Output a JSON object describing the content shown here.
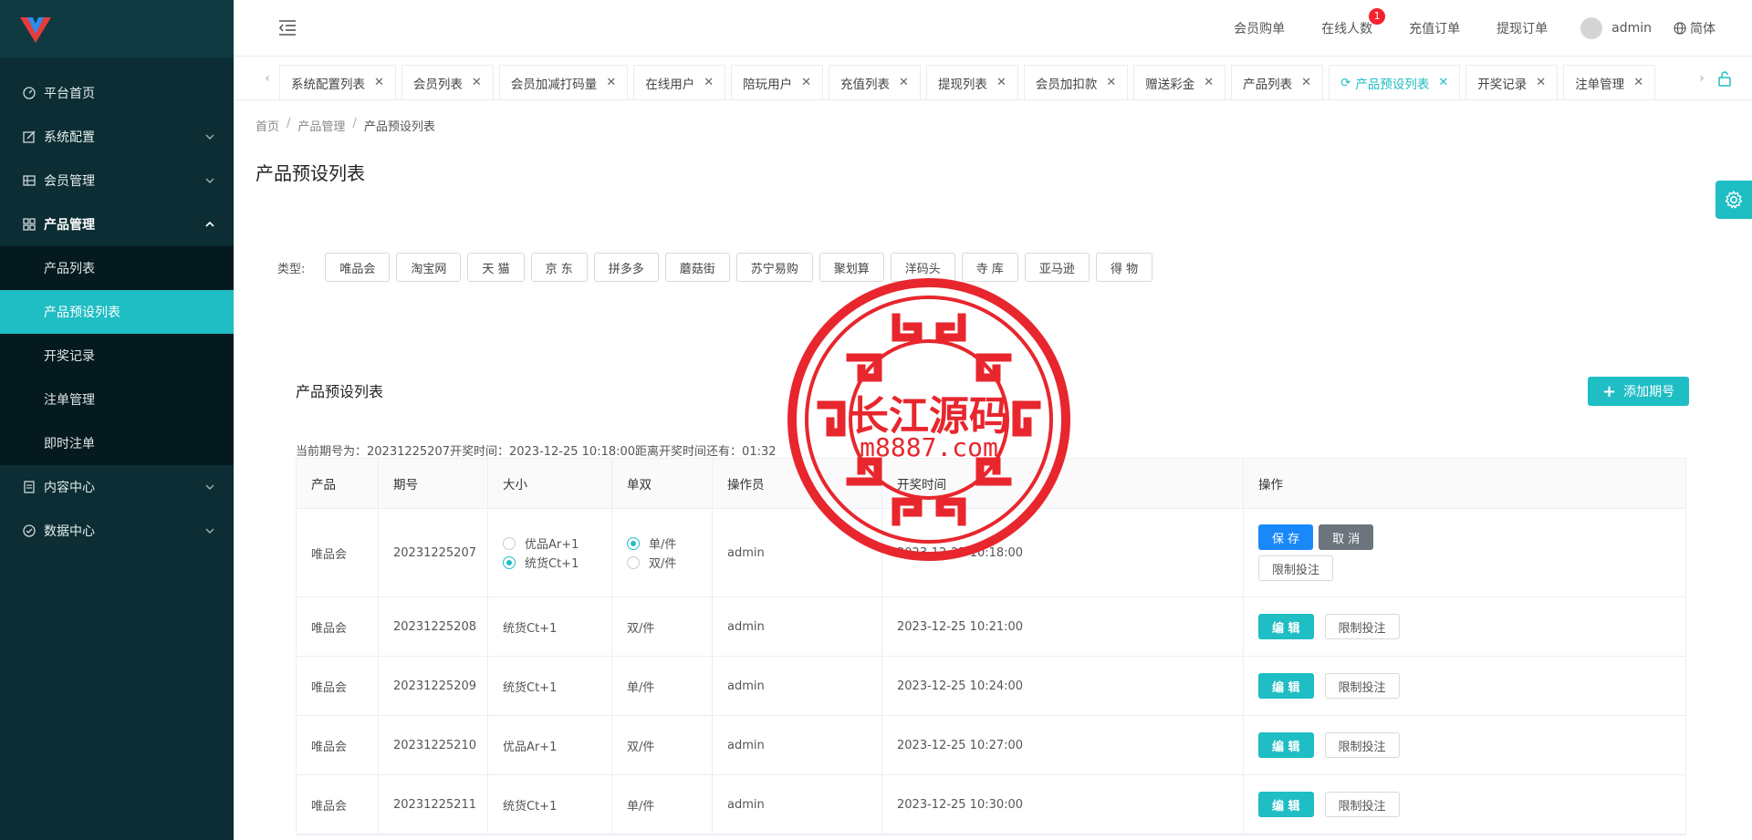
{
  "sidebar": {
    "brand_color": "#e63b3b",
    "items": [
      {
        "label": "平台首页",
        "icon": "dashboard-icon"
      },
      {
        "label": "系统配置",
        "icon": "edit-icon"
      },
      {
        "label": "会员管理",
        "icon": "grid-icon"
      },
      {
        "label": "产品管理",
        "icon": "apps-icon"
      },
      {
        "label": "内容中心",
        "icon": "document-icon"
      },
      {
        "label": "数据中心",
        "icon": "check-circle-icon"
      }
    ],
    "submenu": [
      {
        "label": "产品列表"
      },
      {
        "label": "产品预设列表"
      },
      {
        "label": "开奖记录"
      },
      {
        "label": "注单管理"
      },
      {
        "label": "即时注单"
      }
    ]
  },
  "header": {
    "links": [
      {
        "label": "会员购单"
      },
      {
        "label": "在线人数",
        "badge": "1"
      },
      {
        "label": "充值订单"
      },
      {
        "label": "提现订单"
      }
    ],
    "user": "admin",
    "lang": "简体"
  },
  "tabs": [
    {
      "label": "系统配置列表"
    },
    {
      "label": "会员列表"
    },
    {
      "label": "会员加减打码量"
    },
    {
      "label": "在线用户"
    },
    {
      "label": "陪玩用户"
    },
    {
      "label": "充值列表"
    },
    {
      "label": "提现列表"
    },
    {
      "label": "会员加扣款"
    },
    {
      "label": "赠送彩金"
    },
    {
      "label": "产品列表"
    },
    {
      "label": "产品预设列表"
    },
    {
      "label": "开奖记录"
    },
    {
      "label": "注单管理"
    }
  ],
  "breadcrumb": [
    "首页",
    "产品管理",
    "产品预设列表"
  ],
  "page_title": "产品预设列表",
  "filter": {
    "label": "类型:",
    "types": [
      "唯品会",
      "淘宝网",
      "天 猫",
      "京 东",
      "拼多多",
      "蘑菇街",
      "苏宁易购",
      "聚划算",
      "洋码头",
      "寺 库",
      "亚马逊",
      "得 物"
    ]
  },
  "card": {
    "title": "产品预设列表",
    "add_label": "添加期号",
    "period_info": "当前期号为：20231225207开奖时间：2023-12-25 10:18:00距离开奖时间还有：01:32"
  },
  "table": {
    "headers": [
      "产品",
      "期号",
      "大小",
      "单双",
      "操作员",
      "开奖时间",
      "操作"
    ],
    "edit_row": {
      "product": "唯品会",
      "period": "20231225207",
      "size_options": [
        "优品Ar+1",
        "统货Ct+1"
      ],
      "size_selected": 1,
      "parity_options": [
        "单/件",
        "双/件"
      ],
      "parity_selected": 0,
      "operator": "admin",
      "time": "2023-12-25 10:18:00",
      "save": "保 存",
      "cancel": "取 消",
      "limit": "限制投注"
    },
    "rows": [
      {
        "product": "唯品会",
        "period": "20231225208",
        "size": "统货Ct+1",
        "parity": "双/件",
        "operator": "admin",
        "time": "2023-12-25 10:21:00"
      },
      {
        "product": "唯品会",
        "period": "20231225209",
        "size": "统货Ct+1",
        "parity": "单/件",
        "operator": "admin",
        "time": "2023-12-25 10:24:00"
      },
      {
        "product": "唯品会",
        "period": "20231225210",
        "size": "优品Ar+1",
        "parity": "双/件",
        "operator": "admin",
        "time": "2023-12-25 10:27:00"
      },
      {
        "product": "唯品会",
        "period": "20231225211",
        "size": "统货Ct+1",
        "parity": "单/件",
        "operator": "admin",
        "time": "2023-12-25 10:30:00"
      }
    ],
    "edit_label": "编 辑",
    "limit_label": "限制投注"
  },
  "watermark": {
    "line1": "长江源码",
    "line2": "m8887.com"
  },
  "colors": {
    "accent": "#1fbdc4",
    "sidebar": "#0b2d33",
    "primary": "#1989fa"
  }
}
